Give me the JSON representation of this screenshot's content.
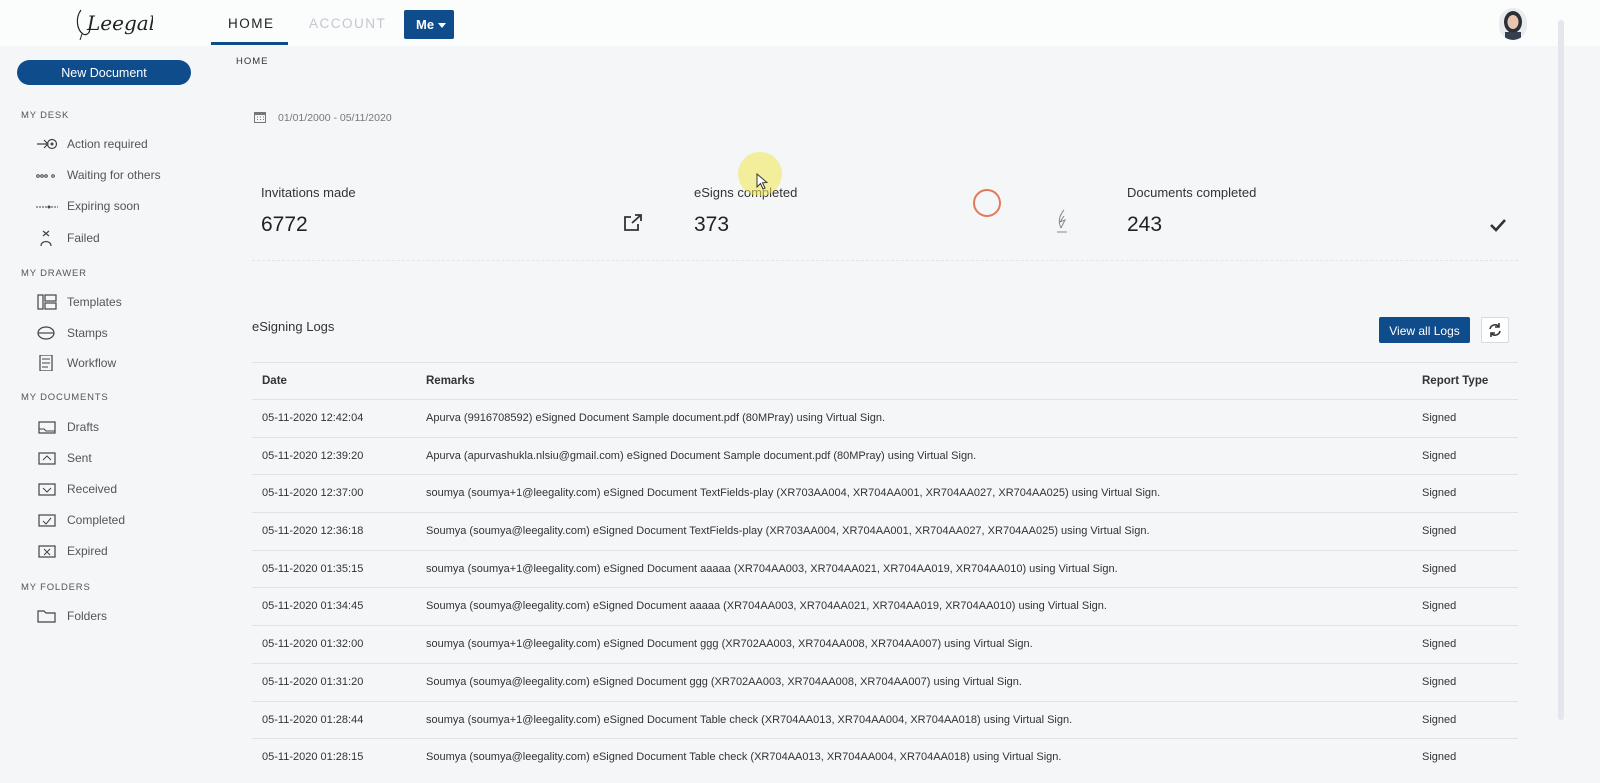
{
  "app": {
    "logo_text": "Leegality",
    "nav": {
      "home": "HOME",
      "account": "ACCOUNT",
      "me_button": "Me"
    },
    "breadcrumb": "HOME",
    "brand_color": "#0e4c8c"
  },
  "sidebar": {
    "new_document": "New Document",
    "sections": [
      {
        "heading": "MY DESK",
        "items": [
          {
            "label": "Action required",
            "icon": "action-required-icon"
          },
          {
            "label": "Waiting for others",
            "icon": "waiting-icon"
          },
          {
            "label": "Expiring soon",
            "icon": "expiring-icon"
          },
          {
            "label": "Failed",
            "icon": "failed-icon"
          }
        ]
      },
      {
        "heading": "MY DRAWER",
        "items": [
          {
            "label": "Templates",
            "icon": "templates-icon"
          },
          {
            "label": "Stamps",
            "icon": "stamps-icon"
          },
          {
            "label": "Workflow",
            "icon": "workflow-icon"
          }
        ]
      },
      {
        "heading": "MY DOCUMENTS",
        "items": [
          {
            "label": "Drafts",
            "icon": "drafts-icon"
          },
          {
            "label": "Sent",
            "icon": "sent-icon"
          },
          {
            "label": "Received",
            "icon": "received-icon"
          },
          {
            "label": "Completed",
            "icon": "completed-icon"
          },
          {
            "label": "Expired",
            "icon": "expired-icon"
          }
        ]
      },
      {
        "heading": "MY FOLDERS",
        "items": [
          {
            "label": "Folders",
            "icon": "folder-icon"
          }
        ]
      }
    ]
  },
  "dashboard": {
    "date_range": "01/01/2000 - 05/11/2020",
    "stats": [
      {
        "title": "Invitations made",
        "value": "6772",
        "icon": "external-link-icon"
      },
      {
        "title": "eSigns completed",
        "value": "373",
        "icon": "pen-nib-icon"
      },
      {
        "title": "Documents completed",
        "value": "243",
        "icon": "checkmark-icon"
      }
    ]
  },
  "logs": {
    "title": "eSigning Logs",
    "view_all": "View all Logs",
    "columns": [
      "Date",
      "Remarks",
      "Report Type"
    ],
    "rows": [
      {
        "date": "05-11-2020 12:42:04",
        "remarks": "Apurva (9916708592) eSigned Document Sample document.pdf (80MPray) using Virtual Sign.",
        "type": "Signed"
      },
      {
        "date": "05-11-2020 12:39:20",
        "remarks": "Apurva (apurvashukla.nlsiu@gmail.com) eSigned Document Sample document.pdf (80MPray) using Virtual Sign.",
        "type": "Signed"
      },
      {
        "date": "05-11-2020 12:37:00",
        "remarks": "soumya (soumya+1@leegality.com) eSigned Document TextFields-play (XR703AA004, XR704AA001, XR704AA027, XR704AA025) using Virtual Sign.",
        "type": "Signed"
      },
      {
        "date": "05-11-2020 12:36:18",
        "remarks": "Soumya (soumya@leegality.com) eSigned Document TextFields-play (XR703AA004, XR704AA001, XR704AA027, XR704AA025) using Virtual Sign.",
        "type": "Signed"
      },
      {
        "date": "05-11-2020 01:35:15",
        "remarks": "soumya (soumya+1@leegality.com) eSigned Document aaaaa (XR704AA003, XR704AA021, XR704AA019, XR704AA010) using Virtual Sign.",
        "type": "Signed"
      },
      {
        "date": "05-11-2020 01:34:45",
        "remarks": "Soumya (soumya@leegality.com) eSigned Document aaaaa (XR704AA003, XR704AA021, XR704AA019, XR704AA010) using Virtual Sign.",
        "type": "Signed"
      },
      {
        "date": "05-11-2020 01:32:00",
        "remarks": "soumya (soumya+1@leegality.com) eSigned Document ggg (XR702AA003, XR704AA008, XR704AA007) using Virtual Sign.",
        "type": "Signed"
      },
      {
        "date": "05-11-2020 01:31:20",
        "remarks": "Soumya (soumya@leegality.com) eSigned Document ggg (XR702AA003, XR704AA008, XR704AA007) using Virtual Sign.",
        "type": "Signed"
      },
      {
        "date": "05-11-2020 01:28:44",
        "remarks": "soumya (soumya+1@leegality.com) eSigned Document Table check (XR704AA013, XR704AA004, XR704AA018) using Virtual Sign.",
        "type": "Signed"
      },
      {
        "date": "05-11-2020 01:28:15",
        "remarks": "Soumya (soumya@leegality.com) eSigned Document Table check (XR704AA013, XR704AA004, XR704AA018) using Virtual Sign.",
        "type": "Signed"
      }
    ]
  }
}
